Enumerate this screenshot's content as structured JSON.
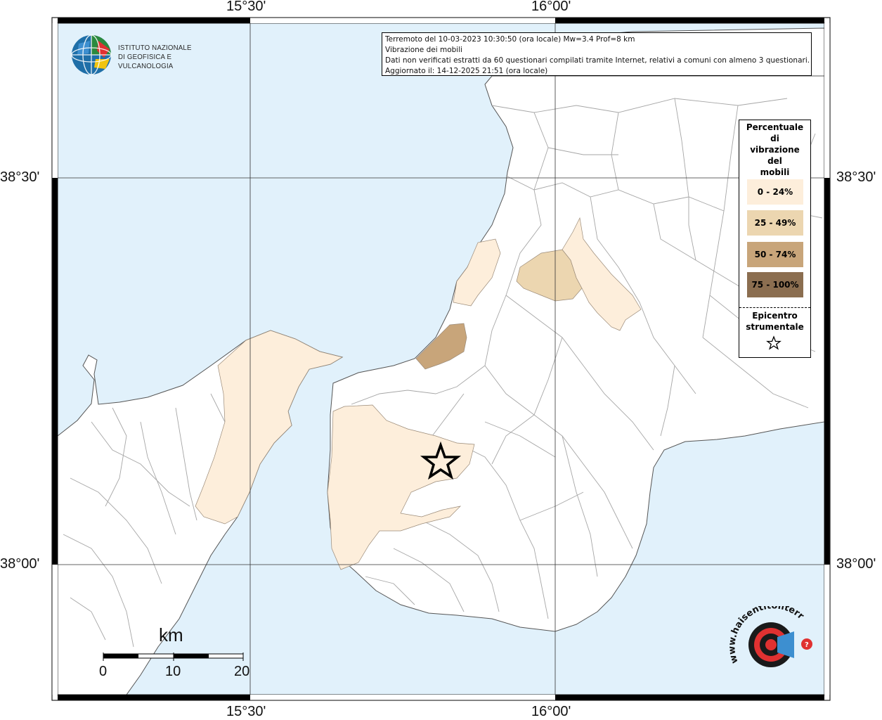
{
  "header": {
    "title_line1": "Terremoto del 10-03-2023 10:30:50 (ora locale) Mw=3.4 Prof=8 km",
    "title_line2": "Vibrazione dei mobili",
    "title_line3": "Dati non verificati estratti da 60 questionari compilati tramite Internet, relativi a comuni con almeno 3 questionari.",
    "title_line4": "Aggiornato il: 14-12-2025 21:51 (ora locale)"
  },
  "axes": {
    "top_left": "15°30'",
    "top_right": "16°00'",
    "bottom_left": "15°30'",
    "bottom_right": "16°00'",
    "left_upper": "38°30'",
    "left_lower": "38°00'",
    "right_upper": "38°30'",
    "right_lower": "38°00'"
  },
  "legend": {
    "title": "Percentuale di vibrazione del mobili",
    "title_lines": [
      "Percentuale",
      "di",
      "vibrazione",
      "del",
      "mobili"
    ],
    "classes": [
      {
        "label": "0 - 24%",
        "color": "#fdeedb"
      },
      {
        "label": "25 - 49%",
        "color": "#ecd6b0"
      },
      {
        "label": "50 - 74%",
        "color": "#c8a57a"
      },
      {
        "label": "75 - 100%",
        "color": "#8b6e50"
      }
    ],
    "epicenter_line1": "Epicentro",
    "epicenter_line2": "strumentale"
  },
  "logo": {
    "line1": "ISTITUTO NAZIONALE",
    "line2": "DI GEOFISICA E VULCANOLOGIA"
  },
  "scale": {
    "unit": "km",
    "ticks": [
      "0",
      "10",
      "20"
    ]
  },
  "watermark": {
    "text": "www.haisentitoilterremoto.it"
  },
  "colors": {
    "sea": "#e1f1fb",
    "land": "#ffffff",
    "boundary": "#a0a0a0"
  }
}
